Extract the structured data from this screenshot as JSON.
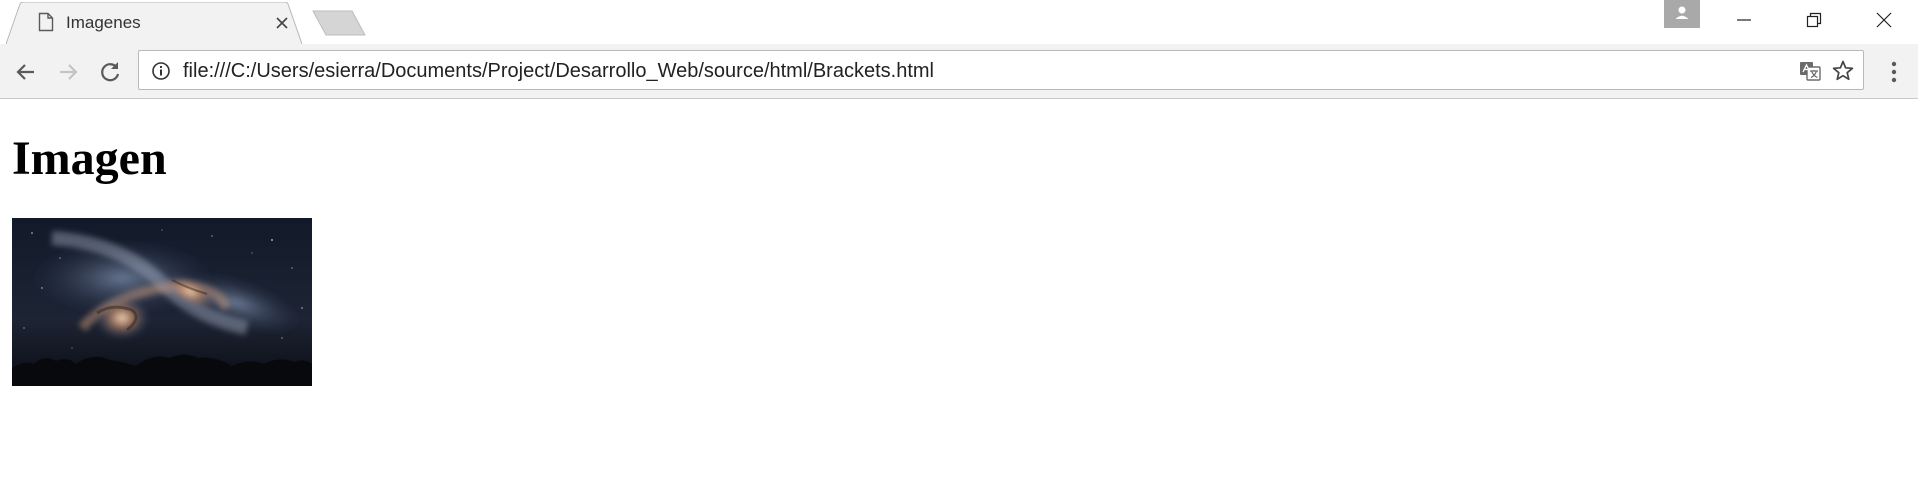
{
  "tab": {
    "title": "Imagenes",
    "favicon": "document-icon",
    "close_icon": "close-icon"
  },
  "new_tab_icon": "new-tab-icon",
  "profile_icon": "person-icon",
  "window_controls": {
    "minimize_icon": "minimize-icon",
    "restore_icon": "restore-icon",
    "close_icon": "close-icon"
  },
  "toolbar": {
    "back_icon": "arrow-left-icon",
    "forward_icon": "arrow-right-icon",
    "reload_icon": "reload-icon",
    "menu_icon": "more-vertical-icon"
  },
  "omnibox": {
    "security_icon": "info-icon",
    "url": "file:///C:/Users/esierra/Documents/Project/Desarrollo_Web/source/html/Brackets.html",
    "translate_icon": "translate-icon",
    "bookmark_icon": "star-icon"
  },
  "page": {
    "heading": "Imagen",
    "image_icon": "galaxy-night-sky-image"
  },
  "colors": {
    "tab_strip_bg": "#ffffff",
    "toolbar_bg": "#f2f2f2",
    "omnibox_border": "#b9b9b9",
    "profile_button_bg": "#a9a9a9"
  }
}
